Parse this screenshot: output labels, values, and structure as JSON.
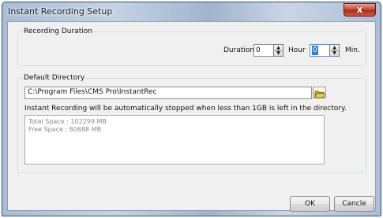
{
  "window": {
    "title": "Instant Recording Setup",
    "close_glyph": "x"
  },
  "recording_duration": {
    "group_label": "Recording Duration",
    "duration_label": "Duration",
    "hour_value": "0",
    "hour_label": "Hour",
    "min_value": "0",
    "min_label": "Min."
  },
  "default_directory": {
    "group_label": "Default Directory",
    "path": "C:\\Program Files\\CMS Pro\\InstantRec",
    "notice": "Instant Recording will be automatically stopped when less than 1GB is left in the directory.",
    "total_space": "Total Space : 102299 MB",
    "free_space": "Free Space : 80688 MB"
  },
  "buttons": {
    "ok_label": "OK",
    "cancel_label": "Cancle"
  },
  "icons": {
    "folder": "folder-open-icon",
    "spin_up": "triangle-up-icon",
    "spin_down": "triangle-down-icon"
  },
  "colors": {
    "close_button": "#c33a22",
    "dialog_background": "#f0f0f0",
    "caption_gradient": "#a7bdd6"
  }
}
